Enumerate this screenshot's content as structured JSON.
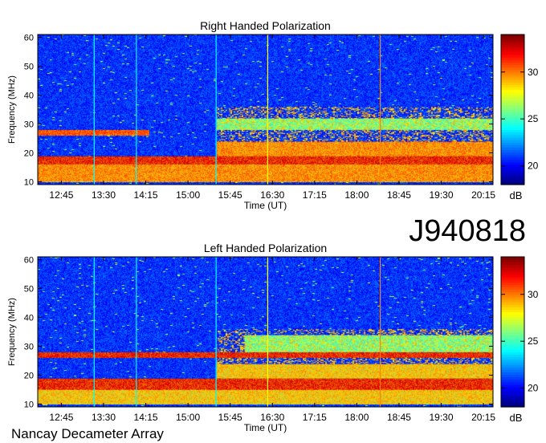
{
  "figure_id": "J940818",
  "footer": "Nancay Decameter Array",
  "colormap": [
    "#00007f",
    "#0000ff",
    "#007fff",
    "#00ffff",
    "#7fff7f",
    "#ffff00",
    "#ff7f00",
    "#ff0000",
    "#7f0000"
  ],
  "chart_data": [
    {
      "type": "heatmap",
      "title": "Right Handed Polarization",
      "xlabel": "Time (UT)",
      "ylabel": "Frequency (MHz)",
      "x_ticks": [
        "12:45",
        "13:30",
        "14:15",
        "15:00",
        "15:45",
        "16:30",
        "17:15",
        "18:00",
        "18:45",
        "19:30",
        "20:15"
      ],
      "x_range_hours": [
        12.33,
        20.42
      ],
      "y_ticks": [
        10,
        20,
        30,
        40,
        50,
        60
      ],
      "ylim": [
        9,
        61
      ],
      "colorbar": {
        "label": "dB",
        "ticks": [
          20,
          25,
          30
        ],
        "range": [
          18,
          34
        ]
      },
      "bands": [
        {
          "freq_mhz": [
            10,
            16
          ],
          "intensity_db": 31,
          "time_hours": [
            12.33,
            20.42
          ]
        },
        {
          "freq_mhz": [
            16,
            19
          ],
          "intensity_db": 33,
          "time_hours": [
            12.33,
            20.42
          ]
        },
        {
          "freq_mhz": [
            19,
            24
          ],
          "intensity_db": 31,
          "time_hours": [
            15.5,
            20.42
          ]
        },
        {
          "freq_mhz": [
            26,
            28
          ],
          "intensity_db": 32,
          "time_hours": [
            12.33,
            14.3
          ]
        },
        {
          "freq_mhz": [
            28,
            32
          ],
          "intensity_db": 27,
          "time_hours": [
            15.5,
            20.42
          ]
        }
      ],
      "vertical_lines": [
        {
          "time": "13:20",
          "color": "#00ffff"
        },
        {
          "time": "14:05",
          "color": "#00ffff"
        },
        {
          "time": "15:30",
          "color": "#00ffff"
        },
        {
          "time": "16:25",
          "color": "#ffff00"
        },
        {
          "time": "18:25",
          "color": "#ff7f00"
        }
      ]
    },
    {
      "type": "heatmap",
      "title": "Left Handed Polarization",
      "xlabel": "Time (UT)",
      "ylabel": "Frequency (MHz)",
      "x_ticks": [
        "12:45",
        "13:30",
        "14:15",
        "15:00",
        "15:45",
        "16:30",
        "17:15",
        "18:00",
        "18:45",
        "19:30",
        "20:15"
      ],
      "x_range_hours": [
        12.33,
        20.42
      ],
      "y_ticks": [
        10,
        20,
        30,
        40,
        50,
        60
      ],
      "ylim": [
        9,
        61
      ],
      "colorbar": {
        "label": "dB",
        "ticks": [
          20,
          25,
          30
        ],
        "range": [
          18,
          34
        ]
      },
      "bands": [
        {
          "freq_mhz": [
            10,
            15
          ],
          "intensity_db": 30,
          "time_hours": [
            12.33,
            20.42
          ]
        },
        {
          "freq_mhz": [
            15,
            19
          ],
          "intensity_db": 33,
          "time_hours": [
            12.33,
            20.42
          ]
        },
        {
          "freq_mhz": [
            19,
            24
          ],
          "intensity_db": 30,
          "time_hours": [
            15.5,
            20.42
          ]
        },
        {
          "freq_mhz": [
            26,
            28
          ],
          "intensity_db": 33,
          "time_hours": [
            12.33,
            20.42
          ]
        },
        {
          "freq_mhz": [
            28,
            34
          ],
          "intensity_db": 27,
          "time_hours": [
            16.0,
            20.42
          ]
        }
      ],
      "vertical_lines": [
        {
          "time": "13:20",
          "color": "#00ffff"
        },
        {
          "time": "14:05",
          "color": "#00ffff"
        },
        {
          "time": "15:30",
          "color": "#00ffff"
        },
        {
          "time": "16:25",
          "color": "#ffff00"
        },
        {
          "time": "18:25",
          "color": "#ff7f00"
        }
      ]
    }
  ]
}
